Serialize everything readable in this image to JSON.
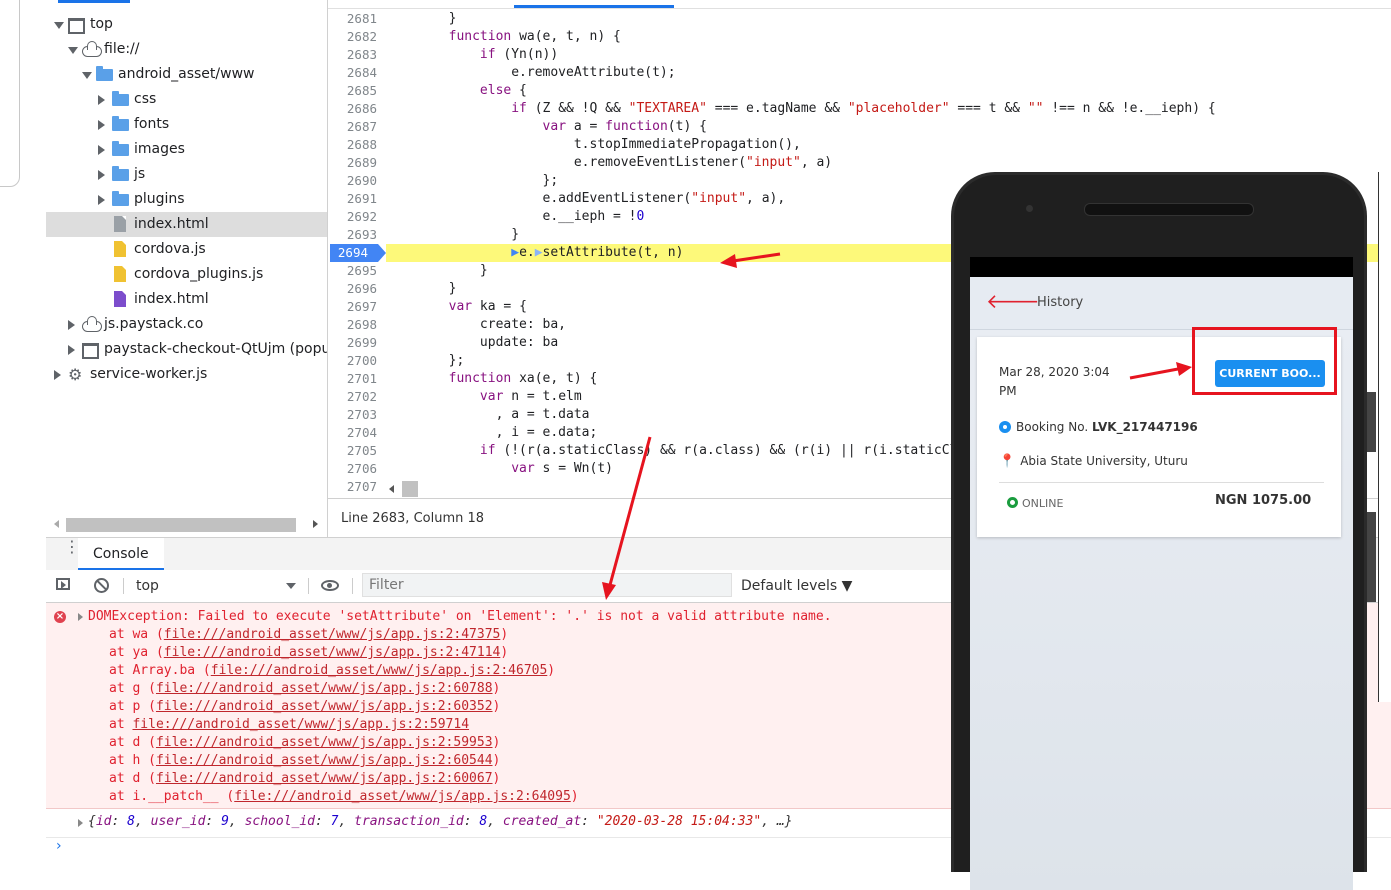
{
  "file_tree": {
    "items": [
      {
        "label": "top",
        "kind": "frame",
        "depth": 0,
        "expanded": true
      },
      {
        "label": "file://",
        "kind": "cloud",
        "depth": 1,
        "expanded": true
      },
      {
        "label": "android_asset/www",
        "kind": "folder",
        "depth": 2,
        "expanded": true
      },
      {
        "label": "css",
        "kind": "folder",
        "depth": 3,
        "expanded": false
      },
      {
        "label": "fonts",
        "kind": "folder",
        "depth": 3,
        "expanded": false
      },
      {
        "label": "images",
        "kind": "folder",
        "depth": 3,
        "expanded": false
      },
      {
        "label": "js",
        "kind": "folder",
        "depth": 3,
        "expanded": false
      },
      {
        "label": "plugins",
        "kind": "folder",
        "depth": 3,
        "expanded": false
      },
      {
        "label": "index.html",
        "kind": "file-gray",
        "depth": 3,
        "selected": true
      },
      {
        "label": "cordova.js",
        "kind": "file-yellow",
        "depth": 3
      },
      {
        "label": "cordova_plugins.js",
        "kind": "file-yellow",
        "depth": 3
      },
      {
        "label": "index.html",
        "kind": "file-purple",
        "depth": 3
      },
      {
        "label": "js.paystack.co",
        "kind": "cloud",
        "depth": 1,
        "expanded": false
      },
      {
        "label": "paystack-checkout-QtUjm (popup",
        "kind": "frame",
        "depth": 1,
        "expanded": false
      },
      {
        "label": "service-worker.js",
        "kind": "gear",
        "depth": 0,
        "expanded": false
      }
    ]
  },
  "editor": {
    "line_numbers": [
      "2681",
      "2682",
      "2683",
      "2684",
      "2685",
      "2686",
      "2687",
      "2688",
      "2689",
      "2690",
      "2691",
      "2692",
      "2693",
      "2694",
      "2695",
      "2696",
      "2697",
      "2698",
      "2699",
      "2700",
      "2701",
      "2702",
      "2703",
      "2704",
      "2705",
      "2706",
      "2707"
    ],
    "paused_line": "2694",
    "status": "Line 2683, Column 18"
  },
  "console": {
    "tab_label": "Console",
    "context": "top",
    "filter_placeholder": "Filter",
    "levels_label": "Default levels ▼",
    "error_message": "DOMException: Failed to execute 'setAttribute' on 'Element': '.' is not a valid attribute name.",
    "stack": [
      {
        "fn": "at wa (",
        "url": "file:///android_asset/www/js/app.js:2:47375",
        "end": ")"
      },
      {
        "fn": "at ya (",
        "url": "file:///android_asset/www/js/app.js:2:47114",
        "end": ")"
      },
      {
        "fn": "at Array.ba (",
        "url": "file:///android_asset/www/js/app.js:2:46705",
        "end": ")"
      },
      {
        "fn": "at g (",
        "url": "file:///android_asset/www/js/app.js:2:60788",
        "end": ")"
      },
      {
        "fn": "at p (",
        "url": "file:///android_asset/www/js/app.js:2:60352",
        "end": ")"
      },
      {
        "fn": "at ",
        "url": "file:///android_asset/www/js/app.js:2:59714",
        "end": ""
      },
      {
        "fn": "at d (",
        "url": "file:///android_asset/www/js/app.js:2:59953",
        "end": ")"
      },
      {
        "fn": "at h (",
        "url": "file:///android_asset/www/js/app.js:2:60544",
        "end": ")"
      },
      {
        "fn": "at d (",
        "url": "file:///android_asset/www/js/app.js:2:60067",
        "end": ")"
      },
      {
        "fn": "at i.__patch__ (",
        "url": "file:///android_asset/www/js/app.js:2:64095",
        "end": ")"
      }
    ],
    "object_preview": {
      "fields": [
        {
          "k": "id",
          "v": "8",
          "t": "num"
        },
        {
          "k": "user_id",
          "v": "9",
          "t": "num"
        },
        {
          "k": "school_id",
          "v": "7",
          "t": "num"
        },
        {
          "k": "transaction_id",
          "v": "8",
          "t": "num"
        },
        {
          "k": "created_at",
          "v": "\"2020-03-28 15:04:33\"",
          "t": "str"
        }
      ],
      "ellipsis": "…"
    },
    "prompt": "›"
  },
  "phone_app": {
    "back_icon": "‹-arrow",
    "title": "History",
    "card": {
      "date": "Mar 28, 2020 3:04 PM",
      "button_label": "CURRENT BOO...",
      "booking_prefix": "Booking No.",
      "booking_no": "LVK_217447196",
      "location": "Abia State University, Uturu",
      "status": "ONLINE",
      "amount": "NGN 1075.00"
    }
  },
  "colors": {
    "accent_blue": "#1a73e8",
    "error_red": "#e0212f",
    "highlight_yellow": "#fdf97a",
    "annotation_red": "#e6141f"
  }
}
